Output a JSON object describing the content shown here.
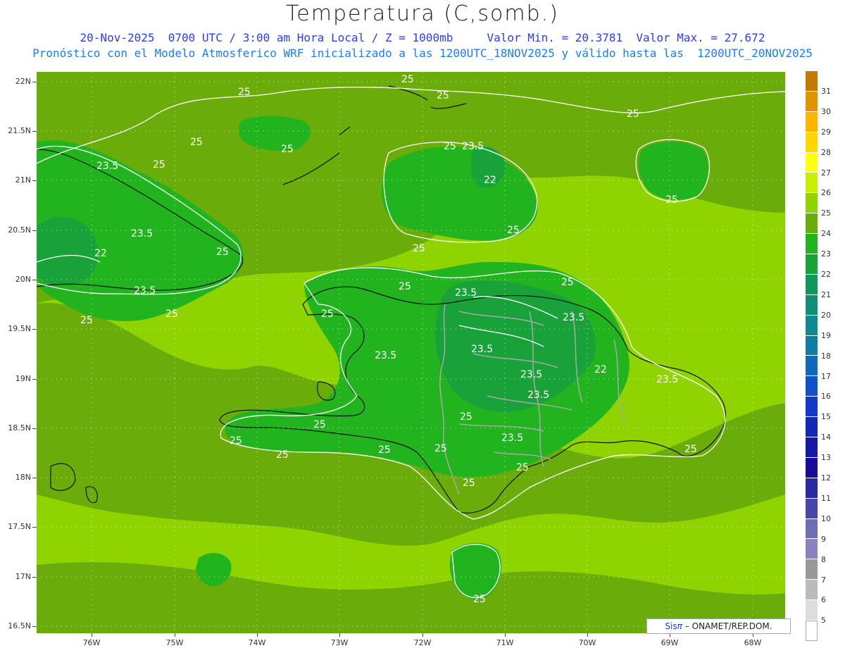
{
  "header": {
    "title": "Temperatura (C,somb.)",
    "line1": "20-Nov-2025  0700 UTC / 3:00 am Hora Local / Z = 1000mb     Valor Min. = 20.3781  Valor Max. = 27.672",
    "line2": "Pronóstico con el Modelo Atmosferico WRF inicializado a las 1200UTC_18NOV2025 y válido hasta las  1200UTC_20NOV2025"
  },
  "axes": {
    "lat_labels": [
      "22N",
      "21.5N",
      "21N",
      "20.5N",
      "20N",
      "19.5N",
      "19N",
      "18.5N",
      "18N",
      "17.5N",
      "17N",
      "16.5N"
    ],
    "lon_labels": [
      "76W",
      "75W",
      "74W",
      "73W",
      "72W",
      "71W",
      "70W",
      "69W",
      "68W"
    ]
  },
  "colorbar": {
    "labels": [
      "31",
      "30",
      "29",
      "28",
      "27",
      "26",
      "25",
      "24",
      "23",
      "22",
      "21",
      "20",
      "19",
      "18",
      "17",
      "16",
      "15",
      "14",
      "13",
      "12",
      "11",
      "10",
      "9",
      "8",
      "7",
      "6",
      "5"
    ],
    "colors": [
      "#c47a00",
      "#e09400",
      "#ffb400",
      "#ffd800",
      "#ffff14",
      "#c8f000",
      "#8fd400",
      "#6aad0a",
      "#22b41e",
      "#1aa23a",
      "#12975a",
      "#0f8f78",
      "#0e8a90",
      "#0f7ca4",
      "#1068b8",
      "#1250c8",
      "#1438c8",
      "#1428b8",
      "#1418a8",
      "#1a0a9a",
      "#2a2aa0",
      "#4648a8",
      "#6e6eb4",
      "#8c82be",
      "#999999",
      "#bbbbbb",
      "#dddddd",
      "#ffffff"
    ]
  },
  "contour_labels": [
    "25",
    "23.5",
    "22"
  ],
  "credit": {
    "brand": "Sis",
    "brand_symbol": "π",
    "org": "– ONAMET/REP.DOM."
  }
}
